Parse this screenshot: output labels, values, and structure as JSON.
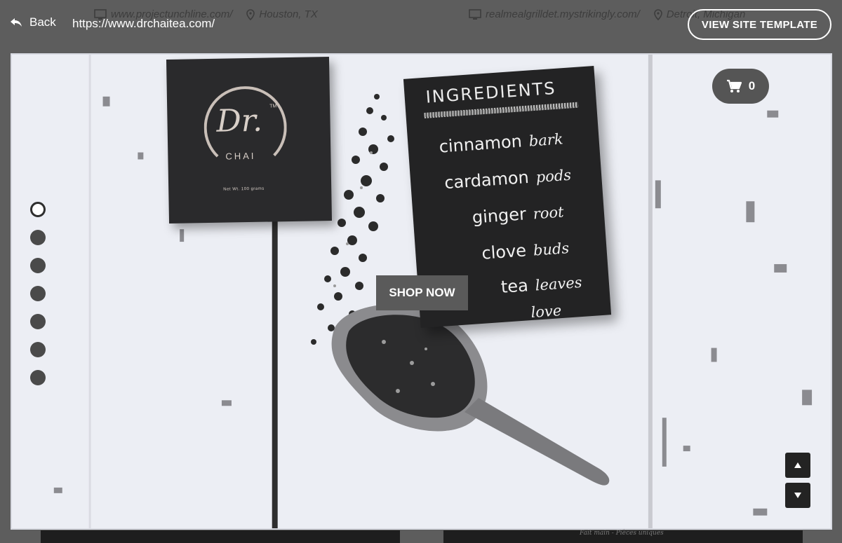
{
  "background_listing": {
    "left_url": "www.projectunchline.com/",
    "left_location": "Houston, TX",
    "right_url": "realmealgrilldet.mystrikingly.com/",
    "right_location": "Detroit, Michigan",
    "bottom_caption": "Fait main - Pièces uniques"
  },
  "topbar": {
    "back_label": "Back",
    "url": "https://www.drchaitea.com/",
    "view_template_label": "VIEW SITE TEMPLATE"
  },
  "hero": {
    "brand_initials": "Dr.",
    "brand_tm": "TM",
    "brand_name": "CHAI",
    "net_weight": "Net Wt. 100 grams",
    "card_title": "INGREDIENTS",
    "ingredients": [
      {
        "main": "cinnamon",
        "note": "bark"
      },
      {
        "main": "cardamon",
        "note": "pods"
      },
      {
        "main": "ginger",
        "note": "root"
      },
      {
        "main": "clove",
        "note": "buds"
      },
      {
        "main": "tea",
        "note": "leaves"
      }
    ],
    "card_footer": "love",
    "shop_label": "SHOP NOW"
  },
  "cart": {
    "count": "0"
  },
  "slides": {
    "total": 7,
    "active_index": 0
  },
  "colors": {
    "chrome": "#5d5d5d",
    "frame_bg": "#eceef4",
    "card": "#232324",
    "button": "#5a5a5a"
  }
}
